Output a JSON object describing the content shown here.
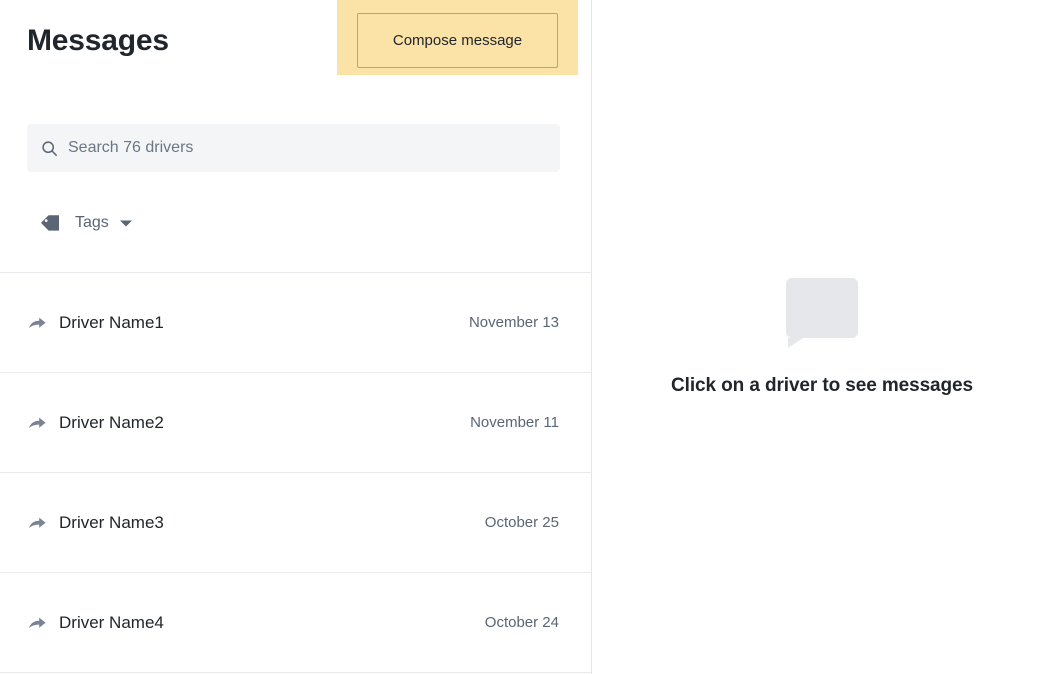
{
  "header": {
    "title": "Messages",
    "compose_label": "Compose message"
  },
  "search": {
    "placeholder": "Search 76 drivers",
    "value": "",
    "icon": "search-icon"
  },
  "filters": {
    "tags_label": "Tags",
    "tag_icon": "tag-icon",
    "caret_icon": "chevron-down-icon"
  },
  "drivers": [
    {
      "name": "Driver Name1",
      "date": "November 13",
      "icon": "forward-arrow-icon"
    },
    {
      "name": "Driver Name2",
      "date": "November 11",
      "icon": "forward-arrow-icon"
    },
    {
      "name": "Driver Name3",
      "date": "October 25",
      "icon": "forward-arrow-icon"
    },
    {
      "name": "Driver Name4",
      "date": "October 24",
      "icon": "forward-arrow-icon"
    }
  ],
  "empty_state": {
    "icon": "speech-bubble-icon",
    "text": "Click on a driver to see messages"
  },
  "colors": {
    "highlight": "#fbe2a7",
    "button_border": "#b3a584",
    "text_primary": "#21262c",
    "text_secondary": "#5a6575",
    "search_bg": "#f4f5f7",
    "divider": "#e8e9ed",
    "bubble": "#e5e7eb"
  }
}
